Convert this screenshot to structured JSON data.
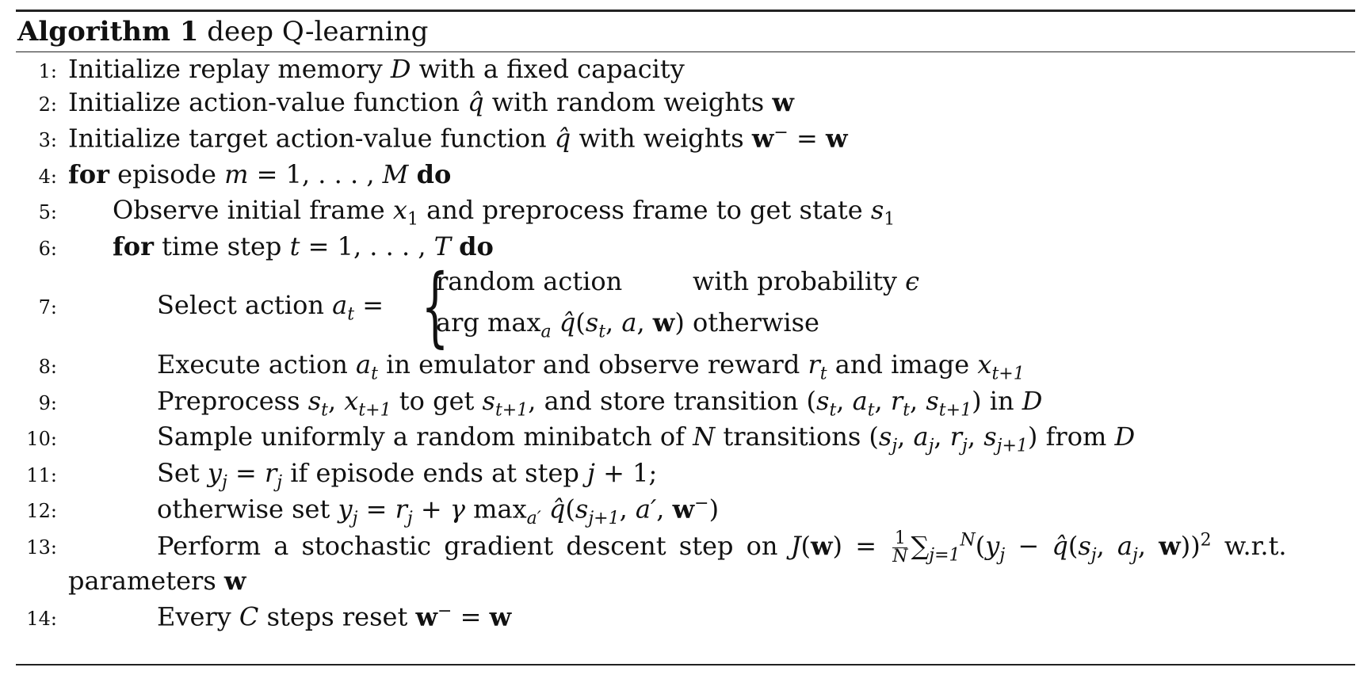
{
  "algorithm": {
    "label": "Algorithm 1",
    "title": "deep Q-learning",
    "lines": [
      {
        "num": "1:",
        "text": "Initialize replay memory D with a fixed capacity"
      },
      {
        "num": "2:",
        "text": "Initialize action-value function q̂ with random weights w"
      },
      {
        "num": "3:",
        "text": "Initialize target action-value function q̂ with weights w⁻ = w"
      },
      {
        "num": "4:",
        "text": "for episode m = 1, . . . , M do"
      },
      {
        "num": "5:",
        "text": "Observe initial frame x₁ and preprocess frame to get state s₁"
      },
      {
        "num": "6:",
        "text": "for time step t = 1, . . . , T do"
      },
      {
        "num": "7:",
        "text": "Select action aₜ =",
        "cases": [
          {
            "value": "random action",
            "condition": "with probability ϵ"
          },
          {
            "value": "arg maxₐ q̂(sₜ, a, w)",
            "condition": "otherwise"
          }
        ]
      },
      {
        "num": "8:",
        "text": "Execute action aₜ in emulator and observe reward rₜ and image xₜ₊₁"
      },
      {
        "num": "9:",
        "text": "Preprocess sₜ, xₜ₊₁ to get sₜ₊₁, and store transition (sₜ, aₜ, rₜ, sₜ₊₁) in D"
      },
      {
        "num": "10:",
        "text": "Sample uniformly a random minibatch of N transitions (sⱼ, aⱼ, rⱼ, sⱼ₊₁) from D"
      },
      {
        "num": "11:",
        "text": "Set yⱼ = rⱼ if episode ends at step j + 1;"
      },
      {
        "num": "12:",
        "text": "otherwise set yⱼ = rⱼ + γ max_a′ q̂(sⱼ₊₁, a′, w⁻)"
      },
      {
        "num": "13:",
        "text": "Perform a stochastic gradient descent step on J(w) = 1/N Σⱼ₌₁ᴺ (yⱼ − q̂(sⱼ, aⱼ, w))² w.r.t. parameters w"
      },
      {
        "num": "14:",
        "text": "Every C steps reset w⁻ = w"
      }
    ]
  },
  "strings": {
    "l1a": "Initialize replay memory ",
    "l1b": "D",
    "l1c": " with a fixed capacity",
    "l2a": "Initialize action-value function ",
    "l2b": "q̂",
    "l2c": " with random weights ",
    "w": "w",
    "l3a": "Initialize target action-value function ",
    "l3c": " with weights ",
    "kw_for": "for",
    "kw_do": "do",
    "l4a": " episode ",
    "l4m": "m",
    "l4b": " = 1, . . . , ",
    "l4M": "M",
    "l5a": "Observe initial frame ",
    "x": "x",
    "one": "1",
    "l5b": " and preprocess frame to get state ",
    "s": "s",
    "l6a": " time step ",
    "t": "t",
    "l6b": " = 1, . . . , ",
    "T": "T",
    "l7a": "Select action ",
    "a": "a",
    "eq": " =",
    "c1v": "random action",
    "c1c": "with probability ",
    "eps": "ϵ",
    "c2v": "arg max",
    "c2c": "otherwise",
    "l8a": "Execute action ",
    "l8b": " in emulator and observe reward ",
    "r": "r",
    "l8c": " and image ",
    "tp1": "t+1",
    "l9a": "Preprocess ",
    "l9b": " to get ",
    "l9c": ", and store transition ",
    "l9d": " in ",
    "l10a": "Sample uniformly a random minibatch of ",
    "N": "N",
    "l10b": " transitions ",
    "l10c": " from ",
    "l11a": "Set ",
    "y": "y",
    "j": "j",
    "l11b": " if episode ends at step ",
    "l11c": " + 1;",
    "l12a": "otherwise set ",
    "gamma": "γ",
    "max": " max",
    "aprime": "a′",
    "jp1": "j+1",
    "l13a": "Perform a stochastic gradient descent step on ",
    "J": "J",
    "sum": "∑",
    "jeq1": "j=1",
    "wrt": " w.r.t.",
    "l13b": "parameters ",
    "l14a": "Every ",
    "C": "C",
    "l14b": " steps reset ",
    "minus": "−"
  }
}
